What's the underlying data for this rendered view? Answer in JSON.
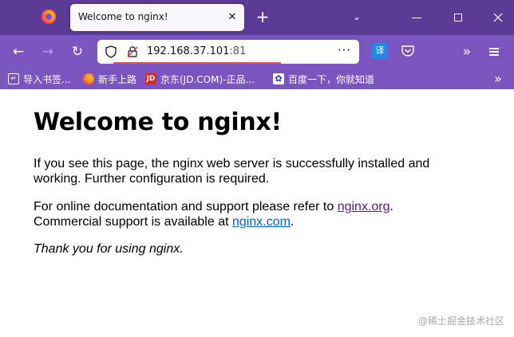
{
  "browser": {
    "tab": {
      "title": "Welcome to nginx!",
      "close": "✕"
    },
    "new_tab": "+",
    "tabs_menu": "⌄",
    "nav": {
      "back": "←",
      "forward": "→",
      "reload": "↻"
    },
    "url": {
      "host": "192.168.37.101",
      "port": ":81"
    },
    "page_actions": "···",
    "translate_icon_text": "译",
    "overflow": "»",
    "bookmarks": [
      {
        "label": "导入书签...",
        "icon": "import-icon"
      },
      {
        "label": "新手上路",
        "icon": "firefox-icon"
      },
      {
        "label": "京东(JD.COM)-正品...",
        "icon": "jd-icon",
        "icon_text": "JD"
      },
      {
        "label": "百度一下，你就知道",
        "icon": "baidu-icon",
        "icon_text": "✿"
      }
    ],
    "bookmarks_more": "»"
  },
  "page": {
    "heading": "Welcome to nginx!",
    "p1": "If you see this page, the nginx web server is successfully installed and working. Further configuration is required.",
    "p2_before": "For online documentation and support please refer to ",
    "p2_link1": "nginx.org",
    "p2_mid": ".",
    "p2_line2": "Commercial support is available at ",
    "p2_link2": "nginx.com",
    "p2_end": ".",
    "p3": "Thank you for using nginx."
  },
  "watermark": "@稀土掘金技术社区",
  "colors": {
    "tabstrip": "#5b3b95",
    "toolbar": "#7a54bf",
    "link": "#0060df",
    "visited_link": "#551a8b"
  }
}
